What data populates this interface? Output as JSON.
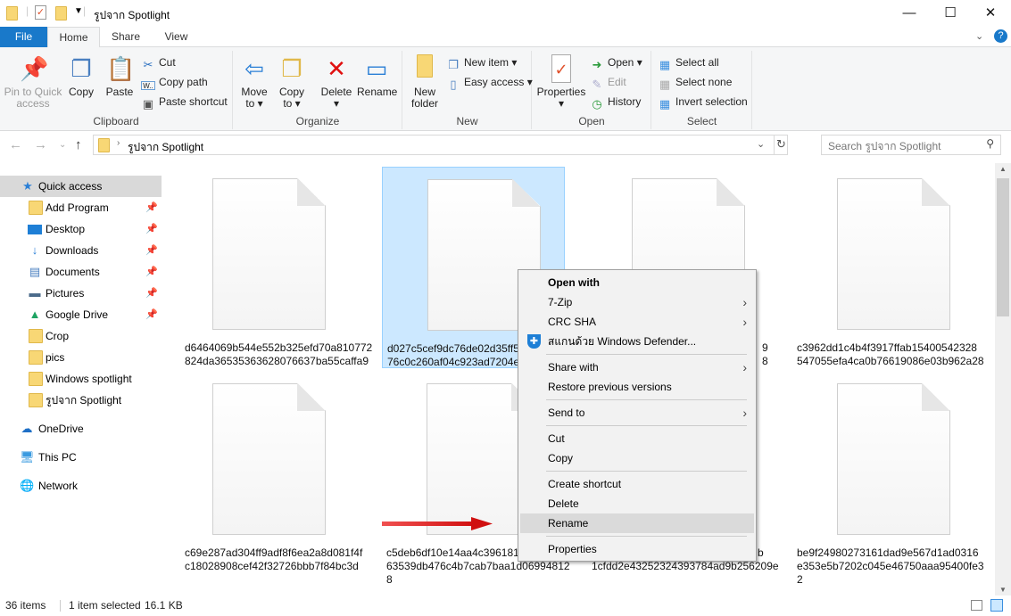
{
  "window": {
    "title": "รูปจาก Spotlight",
    "minimize": "—",
    "maximize": "☐",
    "close": "✕"
  },
  "tabs": [
    {
      "label": "File"
    },
    {
      "label": "Home"
    },
    {
      "label": "Share"
    },
    {
      "label": "View"
    }
  ],
  "ribbon": {
    "clipboard": {
      "label": "Clipboard",
      "pin": "Pin to Quick access",
      "copy": "Copy",
      "paste": "Paste",
      "cut": "Cut",
      "copy_path": "Copy path",
      "paste_shortcut": "Paste shortcut"
    },
    "organize": {
      "label": "Organize",
      "move_to": "Move to",
      "copy_to": "Copy to",
      "delete": "Delete",
      "rename": "Rename"
    },
    "new": {
      "label": "New",
      "new_folder": "New folder",
      "new_item": "New item",
      "easy_access": "Easy access"
    },
    "open": {
      "label": "Open",
      "properties": "Properties",
      "open": "Open",
      "edit": "Edit",
      "history": "History"
    },
    "select": {
      "label": "Select",
      "select_all": "Select all",
      "select_none": "Select none",
      "invert": "Invert selection"
    }
  },
  "address": {
    "path": "รูปจาก Spotlight",
    "search_placeholder": "Search รูปจาก Spotlight"
  },
  "sidebar": {
    "items": [
      {
        "label": "Quick access",
        "pinned": false
      },
      {
        "label": "Add Program",
        "pinned": true
      },
      {
        "label": "Desktop",
        "pinned": true
      },
      {
        "label": "Downloads",
        "pinned": true
      },
      {
        "label": "Documents",
        "pinned": true
      },
      {
        "label": "Pictures",
        "pinned": true
      },
      {
        "label": "Google Drive",
        "pinned": true
      },
      {
        "label": "Crop",
        "pinned": false
      },
      {
        "label": "pics",
        "pinned": false
      },
      {
        "label": "Windows spotlight",
        "pinned": false
      },
      {
        "label": "รูปจาก Spotlight",
        "pinned": false
      },
      {
        "label": "OneDrive",
        "pinned": false
      },
      {
        "label": "This PC",
        "pinned": false
      },
      {
        "label": "Network",
        "pinned": false
      }
    ]
  },
  "files": [
    {
      "l1": "d6464069b544e552b325efd70a810772",
      "l2": "824da36535363628076637ba55caffa9",
      "l3": ""
    },
    {
      "l1": "d027c5cef9dc76de02d35ff5b",
      "l2": "76c0c260af04c923ad7204ea1",
      "l3": ""
    },
    {
      "l1": "9",
      "l2": "8",
      "l3": ""
    },
    {
      "l1": "c3962dd1c4b4f3917ffab15400542328",
      "l2": "547055efa4ca0b76619086e03b962a28",
      "l3": ""
    },
    {
      "l1": "c69e287ad304ff9adf8f6ea2a8d081f4f",
      "l2": "c18028908cef42f32726bbb7f84bc3d",
      "l3": ""
    },
    {
      "l1": "c5deb6df10e14aa4c3961818",
      "l2": "63539db476c4b7cab7baa1d06994812",
      "l3": "8"
    },
    {
      "l1": "b",
      "l2": "1cfdd2e43252324393784ad9b256209e",
      "l3": ""
    },
    {
      "l1": "be9f24980273161dad9e567d1ad0316",
      "l2": "e353e5b7202c045e46750aaa95400fe3",
      "l3": "2"
    }
  ],
  "context_menu": {
    "items": [
      {
        "label": "Open with",
        "bold": true
      },
      {
        "label": "7-Zip",
        "submenu": true
      },
      {
        "label": "CRC SHA",
        "submenu": true
      },
      {
        "label": "สแกนด้วย Windows Defender..."
      },
      {
        "label": "Share with",
        "submenu": true
      },
      {
        "label": "Restore previous versions"
      },
      {
        "label": "Send to",
        "submenu": true
      },
      {
        "label": "Cut"
      },
      {
        "label": "Copy"
      },
      {
        "label": "Create shortcut"
      },
      {
        "label": "Delete"
      },
      {
        "label": "Rename",
        "highlighted": true
      },
      {
        "label": "Properties"
      }
    ]
  },
  "status": {
    "count": "36 items",
    "selection": "1 item selected",
    "size": "16.1 KB"
  },
  "colors": {
    "accent": "#1979ca",
    "selection": "#cce8ff",
    "arrow": "#e02020"
  }
}
